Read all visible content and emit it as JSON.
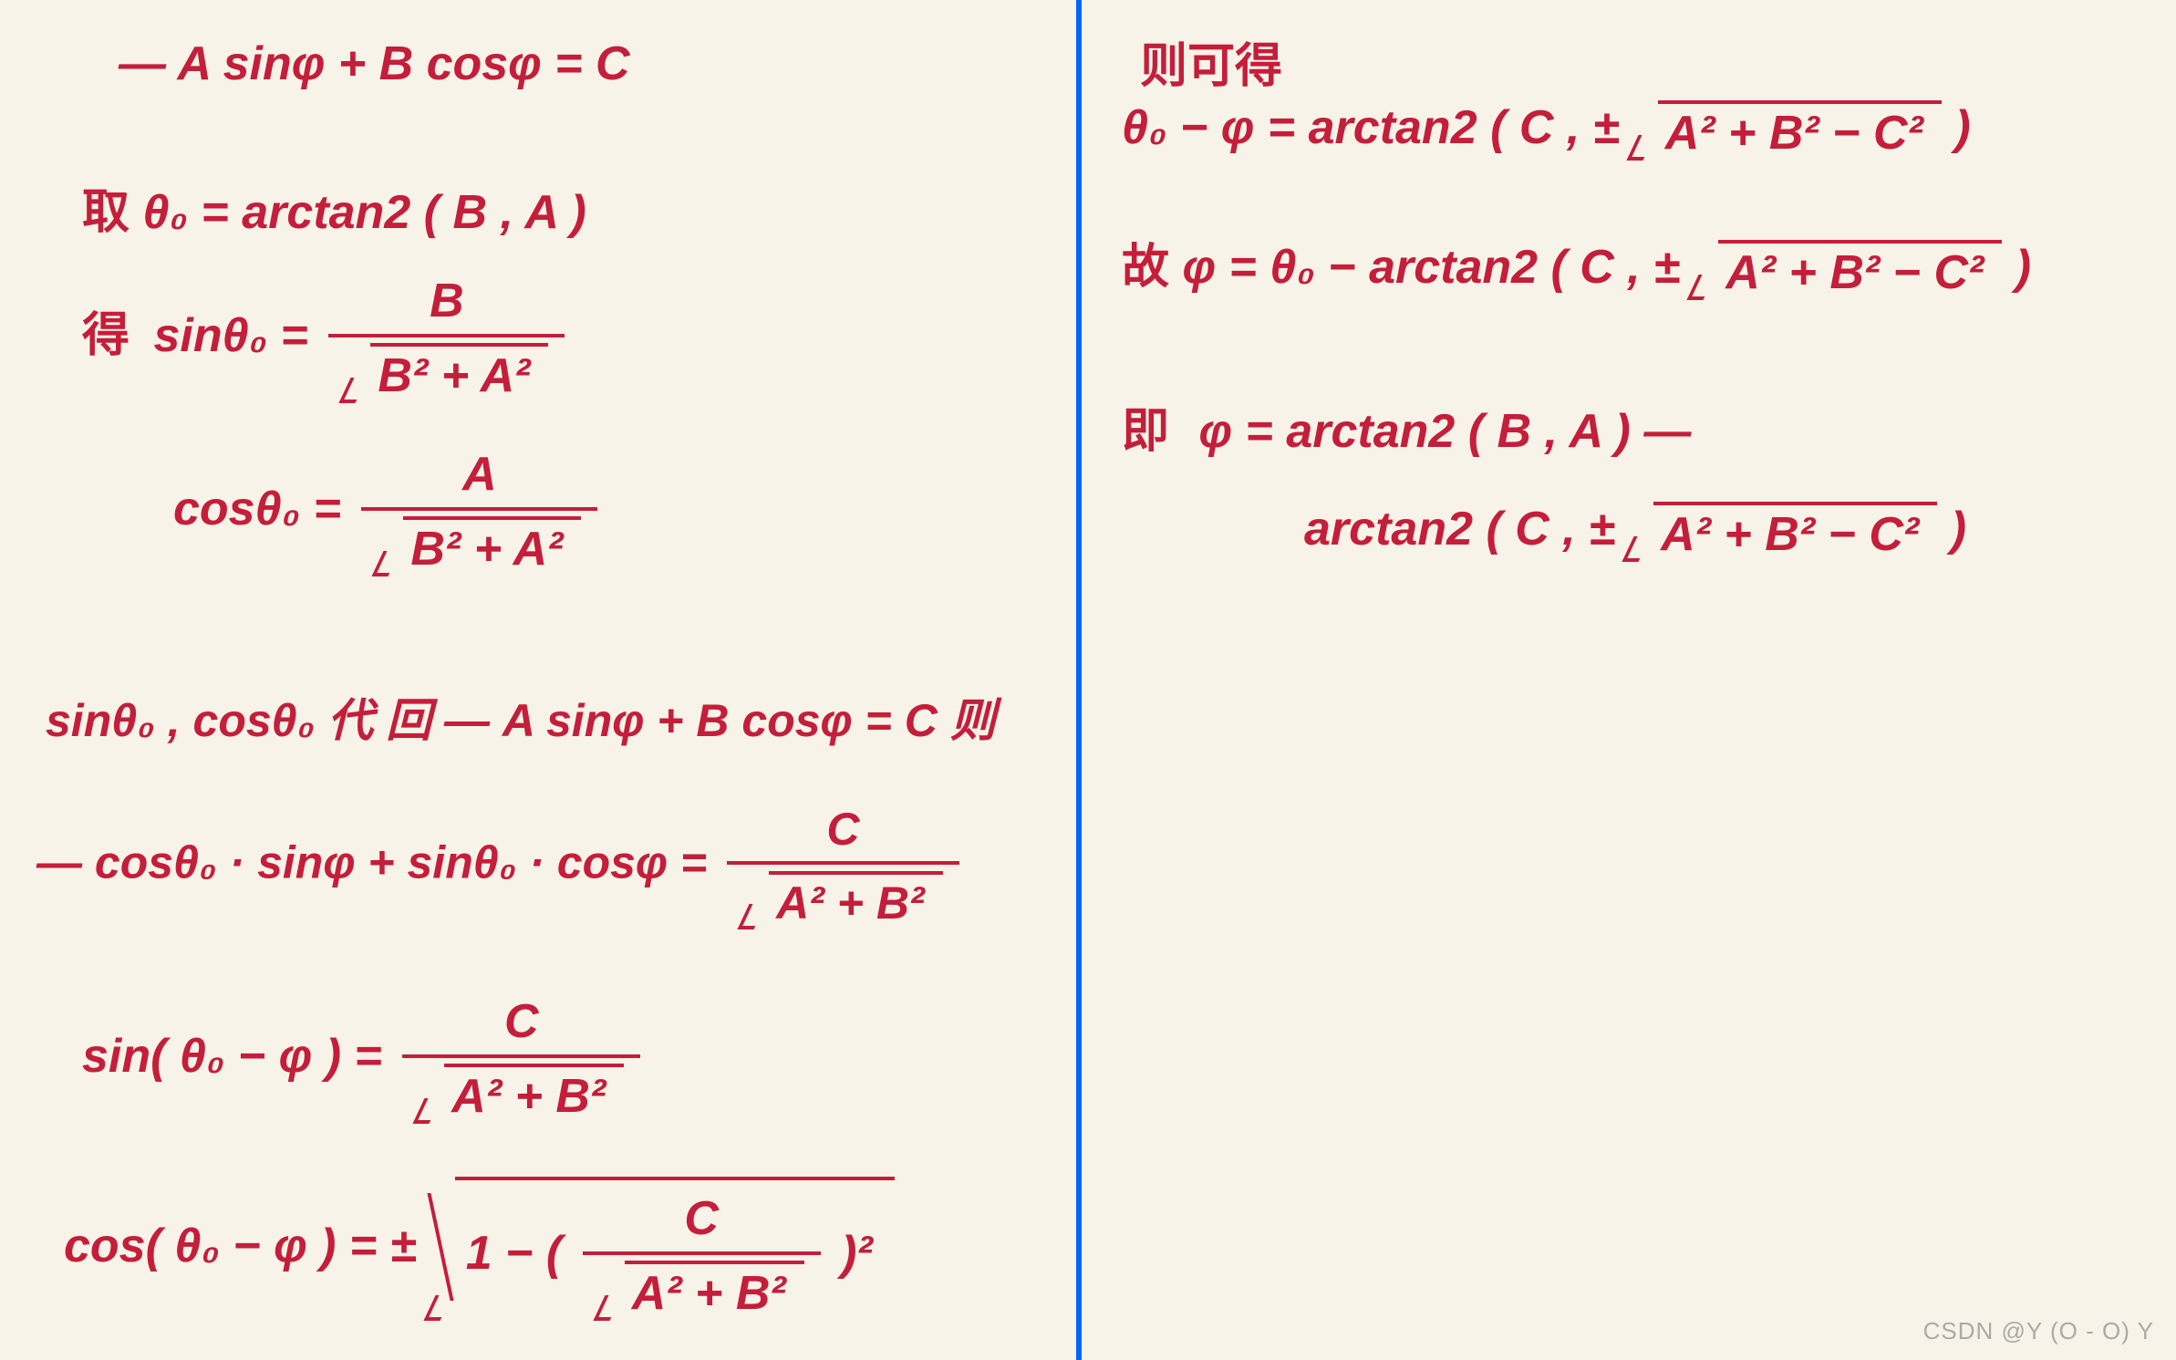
{
  "left": {
    "eq1": "— A sinφ + B cosφ = C",
    "take_label": "取",
    "theta_def": "θ₀ = arctan2 ( B , A )",
    "get_label": "得",
    "sin_theta_lhs": "sinθ₀  =",
    "cos_theta_lhs": "cosθ₀  =",
    "frac_B": "B",
    "frac_A": "A",
    "den_BA": "B² + A²",
    "sub_back": "sinθ₀ , cosθ₀ 代 回   — A sinφ + B cosφ = C 则",
    "eq_cosSin_lhs": "— cosθ₀ · sinφ + sinθ₀ · cosφ  =",
    "frac_C": "C",
    "den_AB": "A² + B²",
    "sin_diff_lhs": "sin( θ₀ − φ )  =",
    "cos_diff_lhs": "cos( θ₀ − φ )  = ±",
    "one_minus": "1 − (",
    "close_sq": ")²"
  },
  "right": {
    "then_get": "则可得",
    "eq_r1_lhs": "θ₀ − φ  =  arctan2 ( C , ±",
    "eq_r1_rad": "A² + B² − C²",
    "close_paren": " )",
    "so_label": "故",
    "eq_r2_lhs": "φ = θ₀ − arctan2 ( C , ±",
    "ie_label": "即",
    "eq_r3a": "φ  =  arctan2 ( B , A )  —",
    "eq_r3b_lhs": "arctan2 ( C , ±",
    "eq_r3b_rad": "A² + B² − C²",
    "close_paren2": ")"
  },
  "watermark": "CSDN @Y (O - O) Y"
}
